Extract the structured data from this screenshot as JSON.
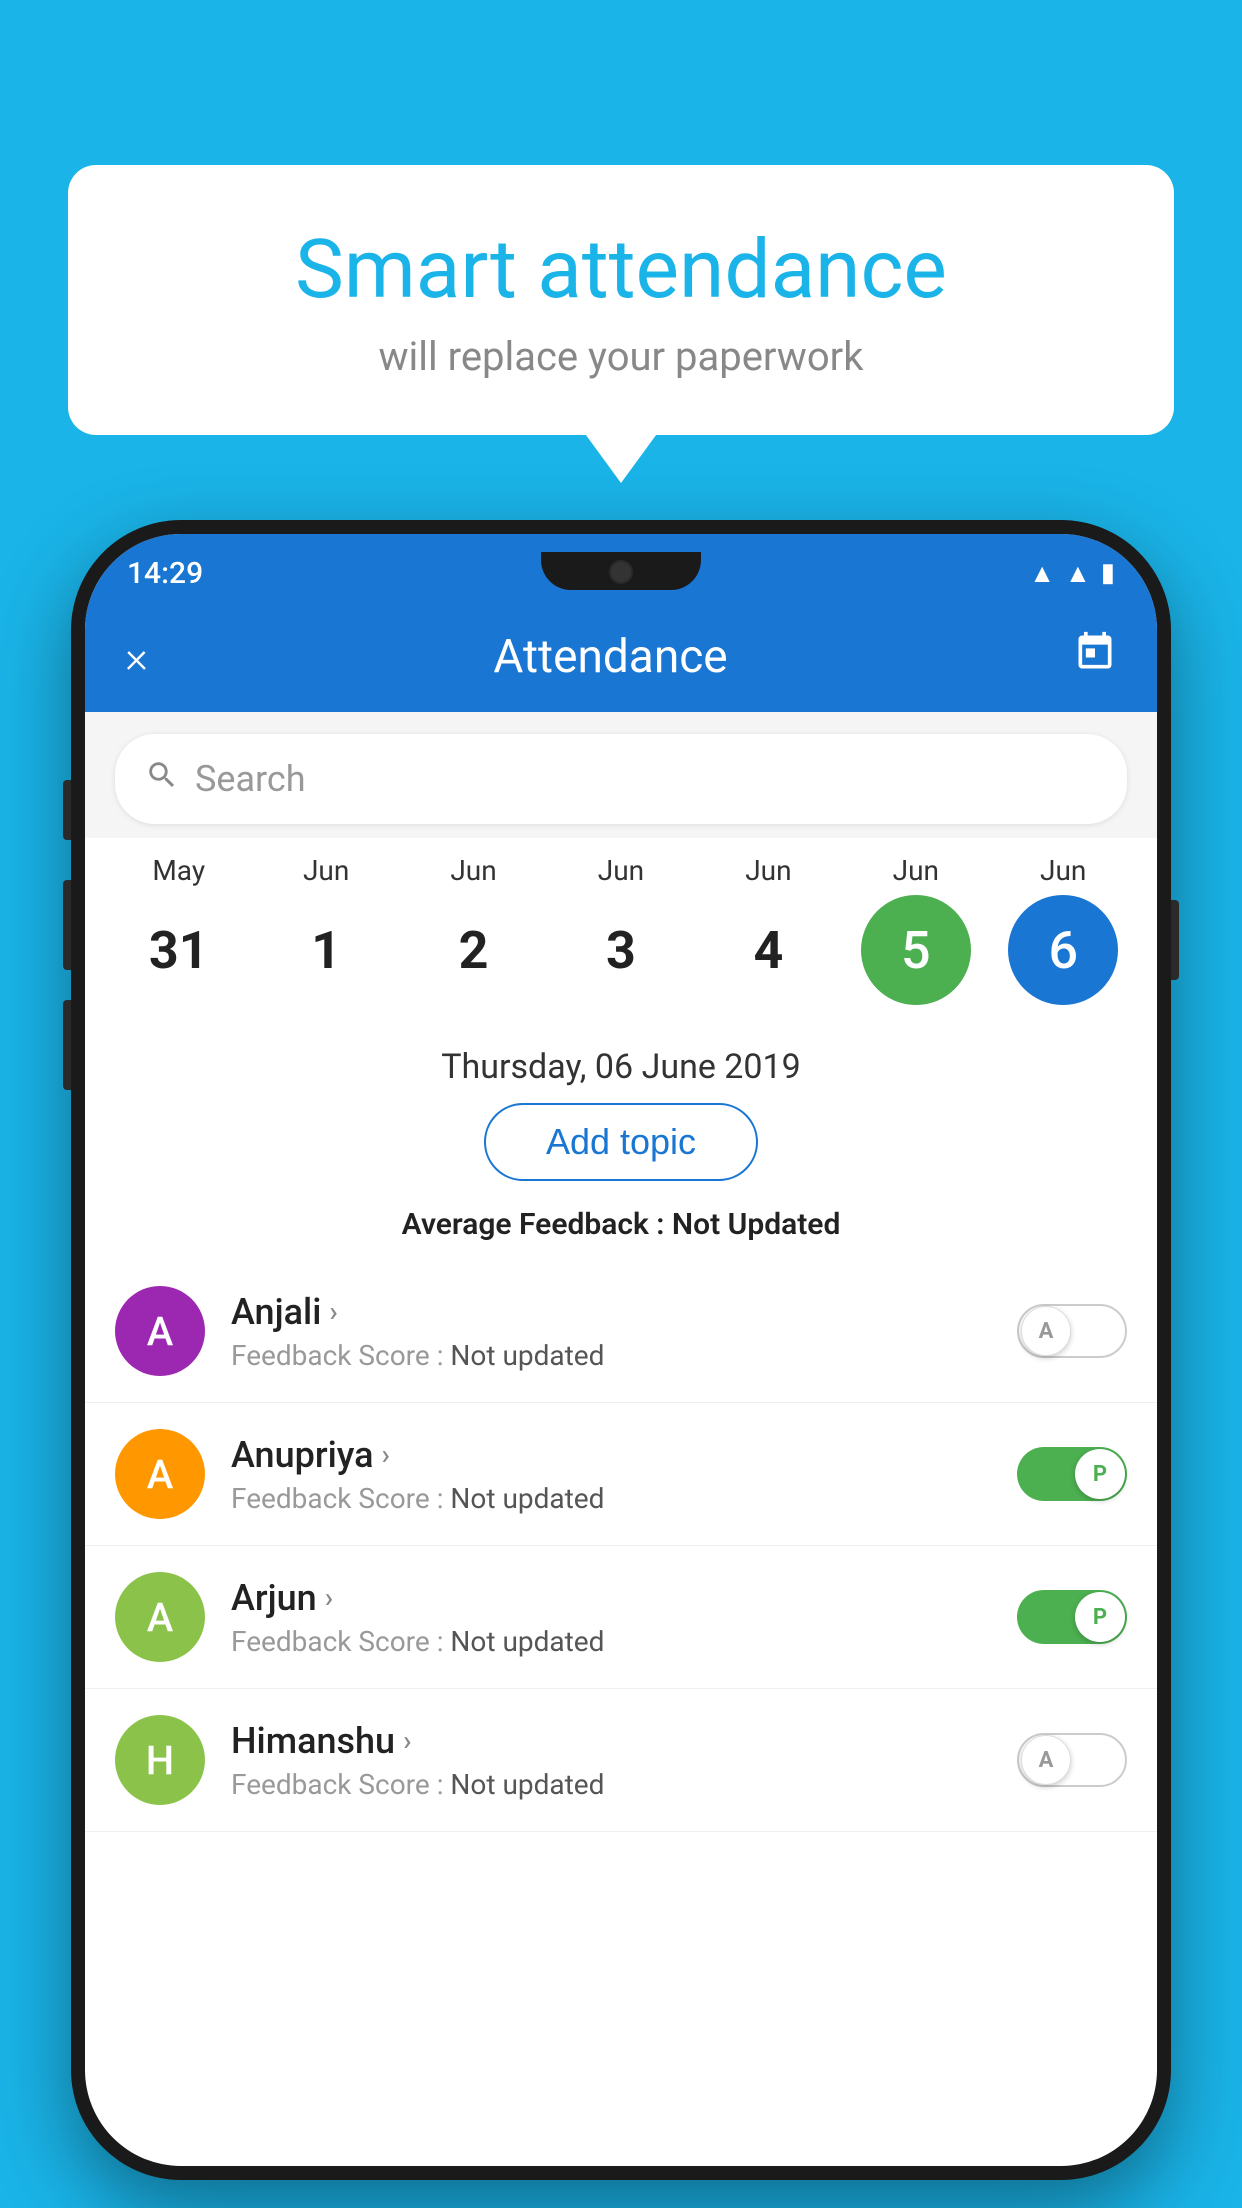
{
  "background_color": "#1ab4e8",
  "speech_bubble": {
    "title": "Smart attendance",
    "subtitle": "will replace your paperwork"
  },
  "status_bar": {
    "time": "14:29",
    "icons": [
      "wifi",
      "signal",
      "battery"
    ]
  },
  "header": {
    "title": "Attendance",
    "close_label": "×",
    "calendar_icon": "📅"
  },
  "search": {
    "placeholder": "Search"
  },
  "calendar": {
    "days": [
      {
        "month": "May",
        "date": "31",
        "selected": false
      },
      {
        "month": "Jun",
        "date": "1",
        "selected": false
      },
      {
        "month": "Jun",
        "date": "2",
        "selected": false
      },
      {
        "month": "Jun",
        "date": "3",
        "selected": false
      },
      {
        "month": "Jun",
        "date": "4",
        "selected": false
      },
      {
        "month": "Jun",
        "date": "5",
        "selected": true,
        "style": "green"
      },
      {
        "month": "Jun",
        "date": "6",
        "selected": true,
        "style": "blue"
      }
    ]
  },
  "selected_date_label": "Thursday, 06 June 2019",
  "add_topic_label": "Add topic",
  "avg_feedback_label": "Average Feedback :",
  "avg_feedback_value": "Not Updated",
  "students": [
    {
      "name": "Anjali",
      "initial": "A",
      "avatar_color": "#9c27b0",
      "feedback_label": "Feedback Score :",
      "feedback_value": "Not updated",
      "toggle": "off",
      "toggle_letter": "A"
    },
    {
      "name": "Anupriya",
      "initial": "A",
      "avatar_color": "#ff9800",
      "feedback_label": "Feedback Score :",
      "feedback_value": "Not updated",
      "toggle": "on",
      "toggle_letter": "P"
    },
    {
      "name": "Arjun",
      "initial": "A",
      "avatar_color": "#8bc34a",
      "feedback_label": "Feedback Score :",
      "feedback_value": "Not updated",
      "toggle": "on",
      "toggle_letter": "P"
    },
    {
      "name": "Himanshu",
      "initial": "H",
      "avatar_color": "#8bc34a",
      "feedback_label": "Feedback Score :",
      "feedback_value": "Not updated",
      "toggle": "off",
      "toggle_letter": "A"
    }
  ]
}
